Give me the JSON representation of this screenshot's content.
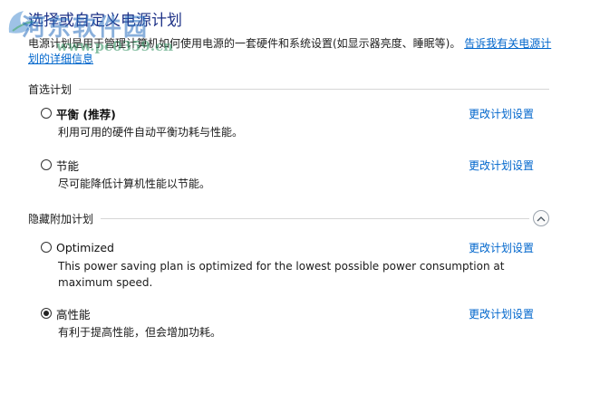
{
  "header": {
    "title": "选择或自定义电源计划",
    "intro_text": "电源计划是用于管理计算机如何使用电源的一套硬件和系统设置(如显示器亮度、睡眠等)。",
    "intro_link": "告诉我有关电源计划的详细信息"
  },
  "watermark": {
    "line1": "河东软件园",
    "line2": "www.pc0359.cn"
  },
  "preferred": {
    "label": "首选计划",
    "plans": [
      {
        "name": "平衡 (推荐)",
        "description": "利用可用的硬件自动平衡功耗与性能。",
        "link": "更改计划设置",
        "selected": false
      },
      {
        "name": "节能",
        "description": "尽可能降低计算机性能以节能。",
        "link": "更改计划设置",
        "selected": false
      }
    ]
  },
  "hidden": {
    "label": "隐藏附加计划",
    "collapse_icon": "chevron-up-icon",
    "plans": [
      {
        "name": "Optimized",
        "description": "This power saving plan is optimized for the lowest possible power consumption at maximum speed.",
        "link": "更改计划设置",
        "selected": false
      },
      {
        "name": "高性能",
        "description": "有利于提高性能，但会增加功耗。",
        "link": "更改计划设置",
        "selected": true
      }
    ]
  },
  "colors": {
    "title": "#1e3287",
    "link": "#0066cc",
    "divider": "#d6d6d6"
  }
}
